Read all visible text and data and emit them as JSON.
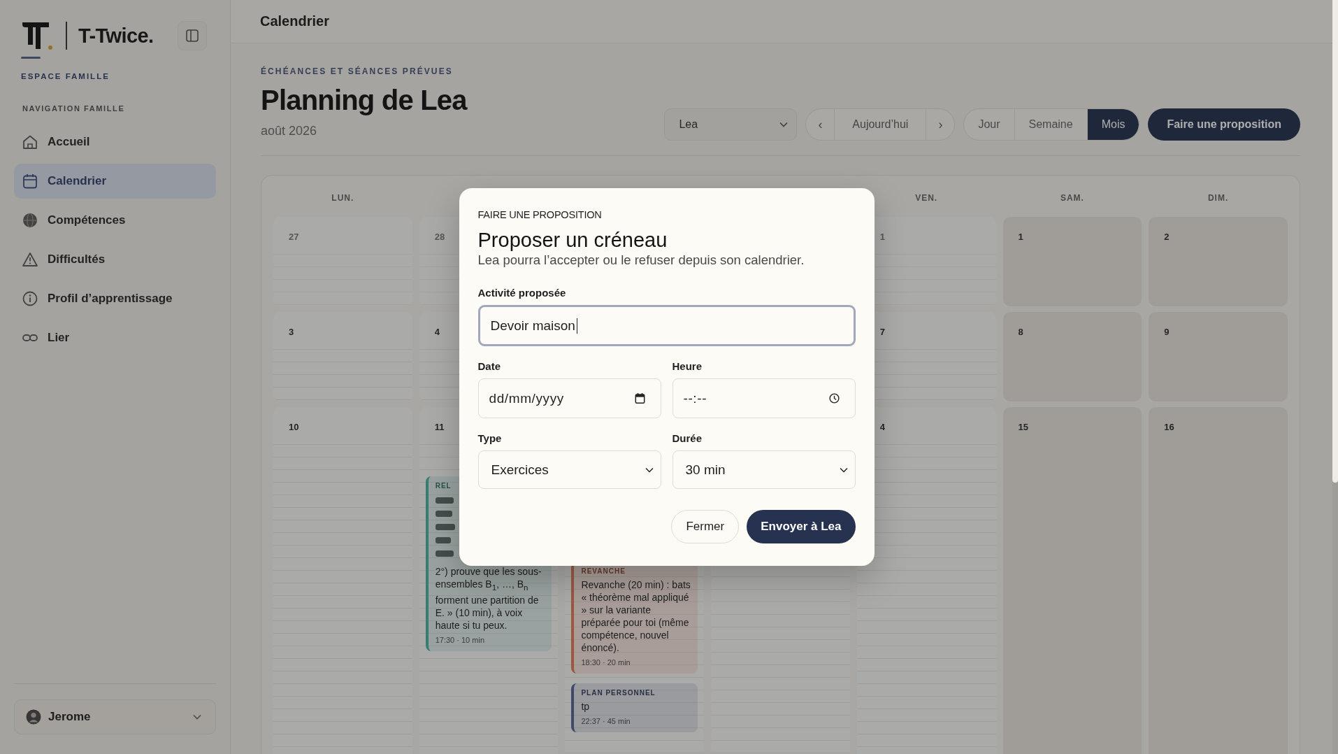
{
  "sidebar": {
    "brand": "T-Twice.",
    "section": "ESPACE FAMILLE",
    "nav_heading": "NAVIGATION FAMILLE",
    "items": [
      {
        "label": "Accueil",
        "selected": false
      },
      {
        "label": "Calendrier",
        "selected": true
      },
      {
        "label": "Compétences",
        "selected": false
      },
      {
        "label": "Difficultés",
        "selected": false
      },
      {
        "label": "Profil d’apprentissage",
        "selected": false
      },
      {
        "label": "Lier",
        "selected": false
      }
    ],
    "user": {
      "name": "Jerome"
    }
  },
  "topbar": {
    "title": "Calendrier"
  },
  "header": {
    "eyebrow": "ÉCHÉANCES ET SÉANCES PRÉVUES",
    "title": "Planning de Lea",
    "subtitle": "août 2026"
  },
  "toolbar": {
    "student_select": "Lea",
    "prev": "‹",
    "today": "Aujourd’hui",
    "next": "›",
    "views": [
      {
        "label": "Jour",
        "selected": false
      },
      {
        "label": "Semaine",
        "selected": false
      },
      {
        "label": "Mois",
        "selected": true
      }
    ],
    "propose_button": "Faire une proposition"
  },
  "calendar": {
    "weekdays_left": [
      "LUN."
    ],
    "weekdays_right": [
      "VEN.",
      "SAM.",
      "DIM."
    ],
    "rows": [
      {
        "cells": [
          {
            "day": "27",
            "kind": "muted"
          },
          {
            "day": "28",
            "kind": "muted"
          },
          {},
          {},
          {
            "day": "1",
            "kind": "muted"
          },
          {
            "day": "1",
            "kind": "weekend"
          },
          {
            "day": "2",
            "kind": "weekend"
          }
        ]
      },
      {
        "cells": [
          {
            "day": "3",
            "kind": "normal"
          },
          {
            "day": "4",
            "kind": "normal"
          },
          {},
          {},
          {
            "day": "7",
            "kind": "normal"
          },
          {
            "day": "8",
            "kind": "weekend"
          },
          {
            "day": "9",
            "kind": "weekend"
          }
        ]
      },
      {
        "cells": [
          {
            "day": "10",
            "kind": "normal"
          },
          {
            "day": "11",
            "kind": "normal",
            "events": [
              {
                "kind": "clipped",
                "label": "REL",
                "color": "#3a7d72",
                "text": "2°) prouve que les sous-ensembles B$_{1}$, …, B$_{n}$ forment une partition de E. » (10 min), à voix haute si tu peux.",
                "time": "17:30 · 10 min"
              }
            ]
          },
          {
            "kind": "normal",
            "events": [
              {
                "kind": "plain",
                "label": "REVANCHE",
                "color": "#9a5840",
                "text": "Revanche (20 min) : bats « théorème mal appliqué » sur la variante préparée pour toi (même compétence, nouvel énoncé).",
                "time": "18:30 · 20 min"
              },
              {
                "kind": "plain",
                "label": "PLAN PERSONNEL",
                "color": "#3f4a6a",
                "text": "tp",
                "time": "22:37 · 45 min"
              }
            ]
          },
          {
            "kind": "normal"
          },
          {
            "day": "4",
            "kind": "normal"
          },
          {
            "day": "15",
            "kind": "weekend"
          },
          {
            "day": "16",
            "kind": "weekend"
          }
        ]
      }
    ]
  },
  "dialog": {
    "eyebrow": "FAIRE UNE PROPOSITION",
    "title": "Proposer un créneau",
    "description": "Lea pourra l’accepter ou le refuser depuis son calendrier.",
    "fields": [
      {
        "kind": "text",
        "label": "Activité proposée",
        "value": "Devoir maison",
        "focused": true
      },
      {
        "kind": "date",
        "label": "Date",
        "placeholder": "dd/mm/yyyy",
        "focused": false
      },
      {
        "kind": "time",
        "label": "Heure",
        "placeholder": "--:--",
        "focused": false
      },
      {
        "kind": "select",
        "label": "Type",
        "value": "Exercices",
        "focused": false
      },
      {
        "kind": "select",
        "label": "Durée",
        "value": "30 min",
        "focused": false
      }
    ],
    "buttons": [
      {
        "label": "Fermer",
        "kind": "secondary"
      },
      {
        "label": "Envoyer à Lea",
        "kind": "primary"
      }
    ]
  }
}
